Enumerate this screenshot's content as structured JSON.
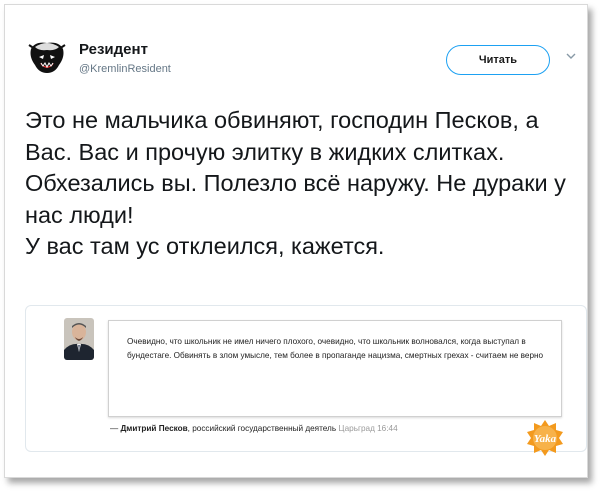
{
  "author": {
    "name": "Резидент",
    "handle": "@KremlinResident"
  },
  "follow_button": {
    "label": "Читать"
  },
  "tweet": {
    "lines": [
      "Это не мальчика обвиняют, господин Песков, а Вас. Вас и прочую элитку в жидких слитках.",
      "Обхезались вы. Полезло всё наружу. Не дураки у нас люди!",
      "У вас там ус отклеился, кажется."
    ]
  },
  "quote": {
    "text": "Очевидно, что школьник не имел ничего плохого, очевидно, что школьник волновался, когда выступал в бундестаге. Обвинять в злом умысле, тем более в пропаганде нацизма, смертных грехах - считаем не верно",
    "dash": "—",
    "author": "Дмитрий Песков",
    "author_title": ", российский государственный деятель",
    "source": "Царьград 16:44"
  },
  "watermark": {
    "text": "Yaka"
  },
  "colors": {
    "accent": "#1da1f2",
    "text": "#14171a",
    "muted": "#657786",
    "watermark": "#f39a1e"
  },
  "icons": {
    "avatar": "honey-badger-avatar-icon",
    "chevron": "chevron-down-icon"
  }
}
